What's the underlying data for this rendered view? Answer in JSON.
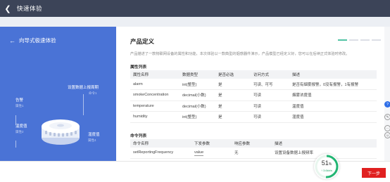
{
  "header": {
    "title": "快速体验"
  },
  "left_panel": {
    "guide_link": "向导式极速体验",
    "labels": {
      "report": "设置数据上报周期",
      "report_sub": "命令1",
      "alarm": "告警",
      "alarm_sub": "属性1",
      "temperature": "温度值",
      "temperature_sub": "属性2",
      "humidity": "湿度值",
      "humidity_sub": "属性4"
    }
  },
  "product": {
    "title": "产品定义",
    "description": "产品描述了一款物联网设备的属性和功能，本次体验以一款典型的烟感器件演示，产品模型已经定义好，您可以在后续正式体验时修改。",
    "properties_label": "属性列表",
    "properties_headers": [
      "属性名称",
      "数据类型",
      "是否必选",
      "访问方式",
      "描述"
    ],
    "properties": [
      [
        "alarm",
        "int(整型)",
        "是",
        "可读、可写",
        "是否有烟雾报警，0没有报警，1有报警"
      ],
      [
        "smokeConcentration",
        "decimal(小数)",
        "是",
        "可读",
        "烟雾浓度值"
      ],
      [
        "temperature",
        "decimal(小数)",
        "是",
        "可读",
        "温度值"
      ],
      [
        "humidity",
        "int(整型)",
        "是",
        "可读",
        "湿度值"
      ]
    ],
    "commands_label": "命令列表",
    "commands_headers": [
      "命令名称",
      "下发参数",
      "响应参数",
      "描述"
    ],
    "commands": [
      [
        "setReportingFrequency",
        "value",
        "无",
        "设置设备数据上报频率"
      ]
    ]
  },
  "progress": {
    "percent": 51,
    "percent_text": "51",
    "unit": "%",
    "sub": "↑ 3.6kb/s"
  },
  "footer": {
    "next_label": "下一步"
  },
  "colors": {
    "topbar": "#3c4458",
    "panel_blue": "#4a73d6",
    "next_button": "#e02020",
    "progress_green": "#22b573"
  }
}
